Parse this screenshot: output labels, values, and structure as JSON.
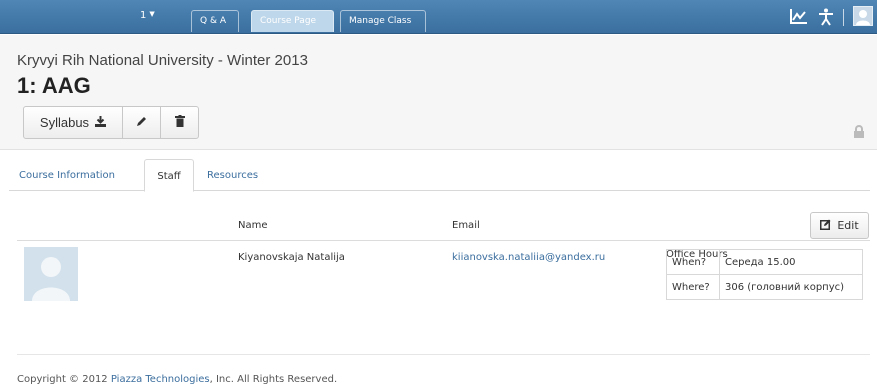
{
  "nav": {
    "class_selector": "1",
    "tabs": [
      "Q & A",
      "Course Page",
      "Manage Class"
    ],
    "active_tab": "Course Page"
  },
  "header": {
    "subtitle": "Kryvyi Rih National University - Winter 2013",
    "title": "1: AAG",
    "syllabus_label": "Syllabus"
  },
  "tabs": {
    "items": [
      "Course Information",
      "Staff",
      "Resources"
    ],
    "active": "Staff"
  },
  "staff_table": {
    "headers": {
      "name": "Name",
      "email": "Email",
      "office_hours": "Office Hours"
    },
    "edit_label": "Edit",
    "rows": [
      {
        "name": "Kiyanovskaja Natalija",
        "email": "kiianovska.nataliia@yandex.ru",
        "hours": [
          {
            "key": "When?",
            "value": "Середа 15.00"
          },
          {
            "key": "Where?",
            "value": "306 (головний корпус)"
          }
        ]
      }
    ]
  },
  "footer": {
    "prefix": "Copyright © 2012 ",
    "company": "Piazza Technologies",
    "suffix": ", Inc. All Rights Reserved."
  },
  "colors": {
    "topbar": "#3f78a8",
    "link": "#3b6e9e",
    "header_bg": "#f6f6f6"
  },
  "icons": [
    "caret-down-icon",
    "stats-icon",
    "accessibility-icon",
    "user-avatar-icon",
    "download-icon",
    "pencil-icon",
    "trash-icon",
    "lock-icon",
    "edit-square-icon",
    "user-placeholder-icon"
  ]
}
